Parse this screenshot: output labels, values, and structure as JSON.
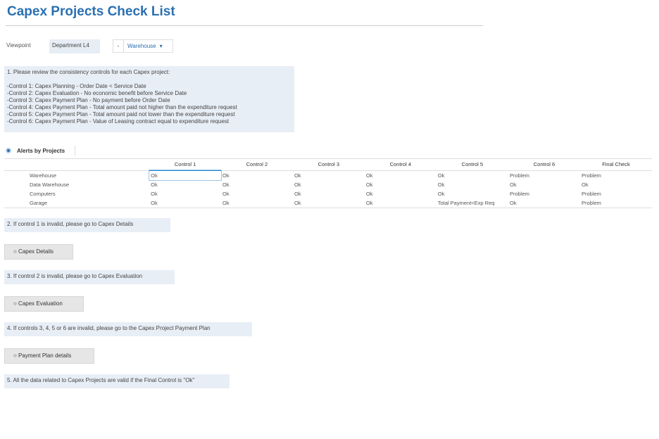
{
  "title": "Capex Projects Check List",
  "viewpoint": {
    "label": "Viewpoint",
    "department": "Department L4",
    "dropdown_prefix": "-",
    "dropdown_value": "Warehouse",
    "dropdown_arrow": "▾"
  },
  "note1": {
    "lines": [
      "1. Please review the consistency controls for each Capex project:",
      "",
      "-Control 1: Capex Planning - Order Date < Service Date",
      "-Control 2: Capex Evaluation - No economic benefit before Service Date",
      "-Control 3: Capex Payment Plan - No payment before Order Date",
      "-Control 4: Capex Payment Plan - Total amount paid not higher than the expenditure request",
      "-Control 5: Capex Payment Plan - Total amount paid not lower than the expenditure request",
      "-Control 6: Capex Payment Plan - Value of Leasing contract equal to expenditure request"
    ]
  },
  "alerts": {
    "title": "Alerts by Projects",
    "columns": [
      "",
      "Control 1",
      "Control 2",
      "Control 3",
      "Control 4",
      "Control 5",
      "Control 6",
      "Final Check"
    ],
    "rows": [
      [
        "Warehouse",
        "Ok",
        "Ok",
        "Ok",
        "Ok",
        "Ok",
        "Problem",
        "Problem"
      ],
      [
        "Data Warehouse",
        "Ok",
        "Ok",
        "Ok",
        "Ok",
        "Ok",
        "Ok",
        "Ok"
      ],
      [
        "Computers",
        "Ok",
        "Ok",
        "Ok",
        "Ok",
        "Ok",
        "Problem",
        "Problem"
      ],
      [
        "Garage",
        "Ok",
        "Ok",
        "Ok",
        "Ok",
        "Total Payment<Exp Req",
        "Ok",
        "Problem"
      ]
    ]
  },
  "note2": "2. If control 1 is invalid, please go to Capex Details",
  "btn1": "○ Capex Details",
  "note3": "3. If control 2 is invalid, please go to Capex Evaluation",
  "btn2": "○ Capex Evaluation",
  "note4": "4. If controls 3, 4, 5 or 6 are invalid, please go to the Capex Project Payment Plan",
  "btn3": "○ Payment Plan details",
  "note5": "5. All the data related to Capex Projects are valid if the Final Control is \"Ok\""
}
